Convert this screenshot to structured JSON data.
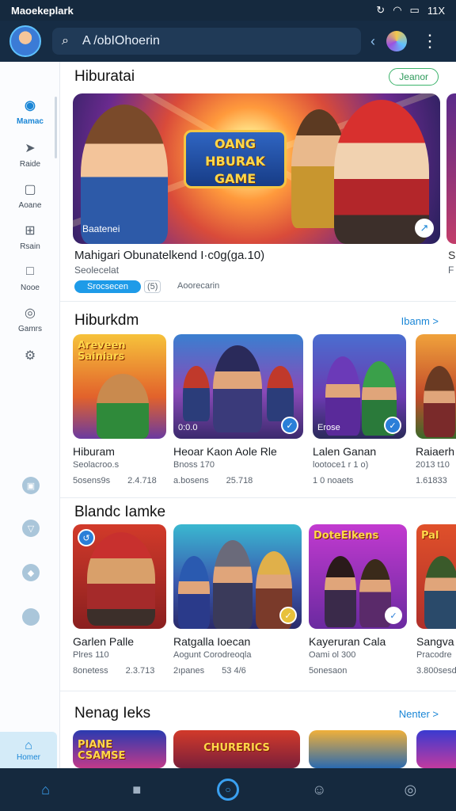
{
  "status_bar": {
    "title": "Maoekeplark",
    "time": "11X"
  },
  "app_bar": {
    "search_value": "A /obIOhoerin"
  },
  "rail": {
    "items": [
      {
        "label": "Mamac",
        "icon": "camera-icon"
      },
      {
        "label": "Raide",
        "icon": "rocket-icon"
      },
      {
        "label": "Aoane",
        "icon": "bag-icon"
      },
      {
        "label": "Rsain",
        "icon": "grid-icon"
      },
      {
        "label": "Nooe",
        "icon": "square-icon"
      },
      {
        "label": "Gamrs",
        "icon": "controller-icon"
      }
    ],
    "bottom_label": "Homer"
  },
  "featured": {
    "title": "Hiburatai",
    "action": "Jeanor",
    "hero_logo": "OANG HBURAK GAME",
    "hero_caption": "Baatenei",
    "hero_title": "Mahigari Obunatelkend I·c0g(ga.10)",
    "hero_subtitle": "Seolecelat",
    "install_label": "Srocsecen",
    "tag": "(5)",
    "meta": "Aoorecarin",
    "peek_title": "S",
    "peek_subtitle": "F"
  },
  "section2": {
    "title": "Hiburkdm",
    "more": "Ibanm >",
    "cards": [
      {
        "art_text": "Areveen Sainiars",
        "badge_text": "",
        "bottom_text": "",
        "name": "Hiburam",
        "sub": "Seolacroo.s",
        "meta1": "5osens9s",
        "meta2": "2.4.718"
      },
      {
        "art_text": "",
        "badge_text": "",
        "bottom_text": "0:0.0",
        "name": "Heoar Kaon Aole Rle",
        "sub": "Bnoss 170",
        "meta1": "a.bosens",
        "meta2": "25.718"
      },
      {
        "art_text": "",
        "badge_text": "",
        "bottom_text": "Erose",
        "name": "Lalen Ganan",
        "sub": "lootoce1 r 1 o)",
        "meta1": "1 0 noaets",
        "meta2": ""
      },
      {
        "art_text": "",
        "badge_text": "",
        "bottom_text": "",
        "name": "Raiaerh",
        "sub": "2013 t10",
        "meta1": "1.61833",
        "meta2": ""
      }
    ]
  },
  "section3": {
    "title": "Blandc Iamke",
    "cards": [
      {
        "art_text": "",
        "name": "Garlen Palle",
        "sub": "Plres 110",
        "meta1": "8onetess",
        "meta2": "2.3.713"
      },
      {
        "art_text": "",
        "name": "Ratgalla Ioecan",
        "sub": "Aogunt Corodreoqla",
        "meta1": "2ıpanes",
        "meta2": "53 4/6"
      },
      {
        "art_text": "DoteElkens",
        "name": "Kayeruran Cala",
        "sub": "Oami ol 300",
        "meta1": "5onesaon",
        "meta2": ""
      },
      {
        "art_text": "Pal",
        "name": "Sangva",
        "sub": "Pracodre",
        "meta1": "3.800sesd",
        "meta2": ""
      }
    ]
  },
  "section4": {
    "title": "Nenag Ieks",
    "more": "Nenter >",
    "cards": [
      {
        "art_text": "PIANE CSAMSE"
      },
      {
        "art_text": "CHURERICS"
      },
      {
        "art_text": ""
      },
      {
        "art_text": ""
      }
    ]
  },
  "colors": {
    "accent": "#1a86d6",
    "bar": "#15293e",
    "green": "#3bb36b"
  }
}
